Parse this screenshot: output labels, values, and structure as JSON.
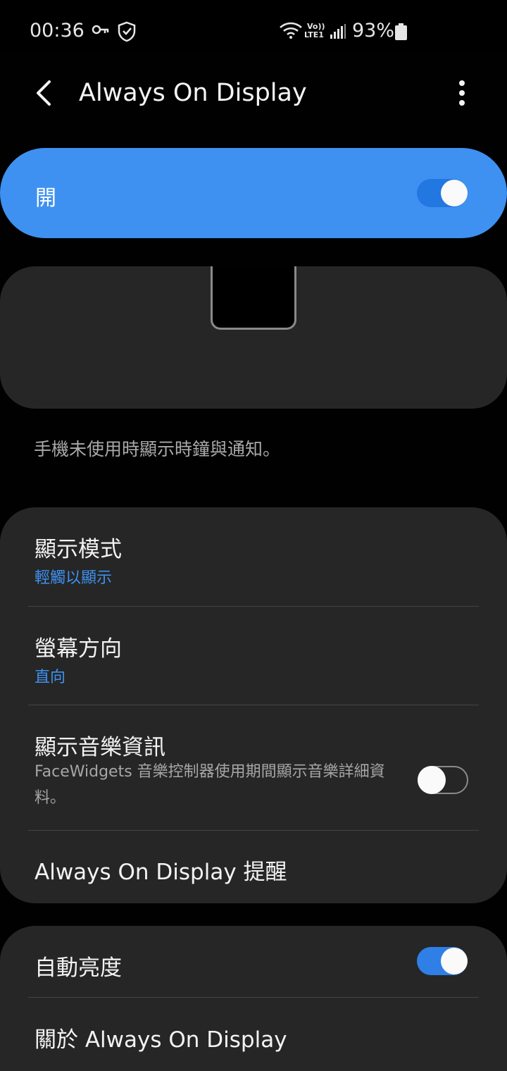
{
  "status_bar": {
    "time": "00:36",
    "icons": [
      "key-icon",
      "shield-icon",
      "wifi-icon",
      "volte-lte1-icon",
      "signal-icon",
      "battery-icon"
    ],
    "network_label_top": "Vo))",
    "network_label_bottom": "LTE1",
    "battery_percent": "93%",
    "battery_level": 0.93
  },
  "app_bar": {
    "title": "Always On Display",
    "back_icon": "chevron-left-icon",
    "menu_icon": "more-vertical-icon"
  },
  "master_switch": {
    "label": "開",
    "enabled": true,
    "accent_color": "#3e91f1"
  },
  "description": "手機未使用時顯示時鐘與通知。",
  "settings": {
    "display_mode": {
      "title": "顯示模式",
      "value": "輕觸以顯示"
    },
    "orientation": {
      "title": "螢幕方向",
      "value": "直向"
    },
    "music_info": {
      "title": "顯示音樂資訊",
      "description": "FaceWidgets 音樂控制器使用期間顯示音樂詳細資料。",
      "enabled": false
    },
    "reminder": {
      "title": "Always On Display 提醒"
    },
    "auto_brightness": {
      "title": "自動亮度",
      "enabled": true
    },
    "about": {
      "title": "關於 Always On Display"
    }
  }
}
